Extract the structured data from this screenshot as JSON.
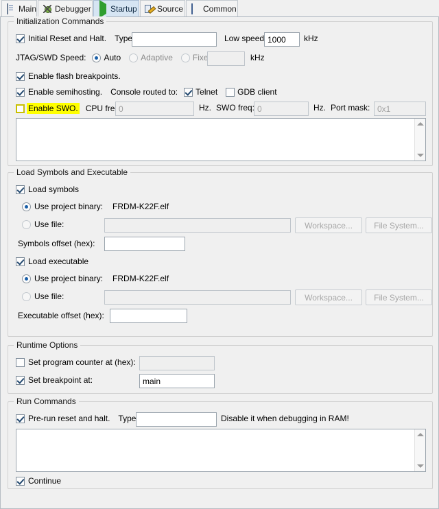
{
  "tabs": [
    {
      "label": "Main",
      "icon": "document-icon",
      "selected": false
    },
    {
      "label": "Debugger",
      "icon": "bug-icon",
      "selected": false
    },
    {
      "label": "Startup",
      "icon": "play-icon",
      "selected": true
    },
    {
      "label": "Source",
      "icon": "source-edit-icon",
      "selected": false
    },
    {
      "label": "Common",
      "icon": "table-icon",
      "selected": false
    }
  ],
  "init_commands": {
    "title": "Initialization Commands",
    "initial_reset_label": "Initial Reset and Halt.",
    "initial_reset_checked": true,
    "type_label": "Type:",
    "type_value": "",
    "low_speed_label": "Low speed:",
    "low_speed_value": "1000",
    "low_speed_unit": "kHz",
    "jtag_speed_label": "JTAG/SWD Speed:",
    "speed_auto_label": "Auto",
    "speed_adaptive_label": "Adaptive",
    "speed_fixed_label": "Fixed",
    "speed_selected": "Auto",
    "fixed_value": "",
    "fixed_unit": "kHz",
    "flash_breakpoints_label": "Enable flash breakpoints.",
    "flash_breakpoints_checked": true,
    "semihosting_label": "Enable semihosting.",
    "semihosting_checked": true,
    "console_routed_label": "Console routed to:",
    "telnet_label": "Telnet",
    "telnet_checked": true,
    "gdb_client_label": "GDB client",
    "gdb_client_checked": false,
    "swo_label": "Enable SWO.",
    "swo_checked": false,
    "swo_highlight_color": "#ffff00",
    "cpu_freq_label": "CPU freq:",
    "cpu_freq_value": "0",
    "cpu_freq_unit": "Hz.",
    "swo_freq_label": "SWO freq:",
    "swo_freq_value": "0",
    "swo_freq_unit": "Hz.",
    "port_mask_label": "Port mask:",
    "port_mask_value": "0x1",
    "commands_text": ""
  },
  "load_section": {
    "title": "Load Symbols and Executable",
    "load_symbols_label": "Load symbols",
    "load_symbols_checked": true,
    "symbols_project_binary_label": "Use project binary:",
    "symbols_project_binary_value": "FRDM-K22F.elf",
    "symbols_use_file_label": "Use file:",
    "symbols_use_file_value": "",
    "symbols_source_selected": "project-binary",
    "workspace_button": "Workspace...",
    "file_system_button": "File System...",
    "symbols_offset_label": "Symbols offset (hex):",
    "symbols_offset_value": "",
    "load_executable_label": "Load executable",
    "load_executable_checked": true,
    "exec_project_binary_label": "Use project binary:",
    "exec_project_binary_value": "FRDM-K22F.elf",
    "exec_use_file_label": "Use file:",
    "exec_use_file_value": "",
    "exec_source_selected": "project-binary",
    "executable_offset_label": "Executable offset (hex):",
    "executable_offset_value": ""
  },
  "runtime_options": {
    "title": "Runtime Options",
    "set_pc_label": "Set program counter at (hex):",
    "set_pc_checked": false,
    "set_pc_value": "",
    "set_breakpoint_label": "Set breakpoint at:",
    "set_breakpoint_checked": true,
    "set_breakpoint_value": "main"
  },
  "run_commands": {
    "title": "Run Commands",
    "prerun_label": "Pre-run reset and halt.",
    "prerun_checked": true,
    "type_label": "Type:",
    "type_value": "",
    "warning_text": "Disable it when debugging in RAM!",
    "commands_text": "",
    "continue_label": "Continue",
    "continue_checked": true
  }
}
